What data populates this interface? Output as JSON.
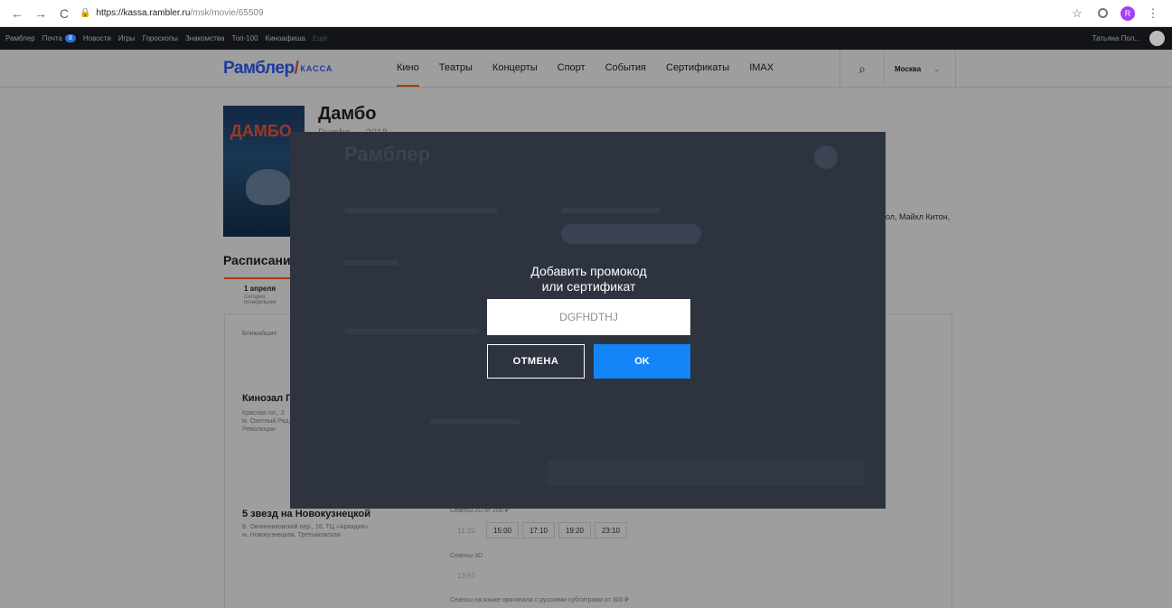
{
  "browser": {
    "url_host": "https://kassa.rambler.ru",
    "url_path": "/msk/movie/65509",
    "profile_initial": "R"
  },
  "topbar": {
    "links": [
      "Рамблер",
      "Почта",
      "Новости",
      "Игры",
      "Гороскопы",
      "Знакомства",
      "Топ-100",
      "Кинoафиша",
      "Ещё"
    ],
    "mail_count": "8",
    "user_name": "Татьяна Пол..."
  },
  "header": {
    "logo": "Рамблер",
    "logo_sub": "КАССА",
    "menu": [
      "Кино",
      "Театры",
      "Концерты",
      "Спорт",
      "События",
      "Сертификаты",
      "IMAX"
    ],
    "city": "Москва"
  },
  "movie": {
    "poster_text": "ДАМБО",
    "title": "Дамбо",
    "subtitle": "Dumbo — 2018",
    "cast_tail": "ол, Майкл Китон,"
  },
  "schedule": {
    "title": "Расписание",
    "date": "1 апреля",
    "date_sub": "Сегодня, понедельник",
    "nearby": "Ближайшие",
    "cinemas": [
      {
        "name": "Кинозал ГУМа",
        "address": [
          "Красная пл., 3",
          "м. Охотный Ряд,",
          "Революции"
        ]
      },
      {
        "name": "5 звезд на Новокузнецкой",
        "address": [
          "Б. Овчинниковский пер., 16, ТЦ «Аркадия»",
          "м. Новокузнецкая, Третьяковская"
        ],
        "label_2d": "Сеансы 2D от 200 ₽",
        "times_2d": [
          "11:10",
          "15:00",
          "17:10",
          "19:20",
          "23:10"
        ],
        "label_3d": "Сеансы 3D",
        "times_3d": [
          "13:50"
        ],
        "label_orig": "Сеансы на языке оригинала с русскими субтитрами от 300 ₽"
      }
    ]
  },
  "promo_dialog": {
    "title_line1": "Добавить промокод",
    "title_line2": "или сертификат",
    "input_value": "DGFHDTHJ",
    "cancel_label": "ОТМЕНА",
    "ok_label": "OK"
  }
}
